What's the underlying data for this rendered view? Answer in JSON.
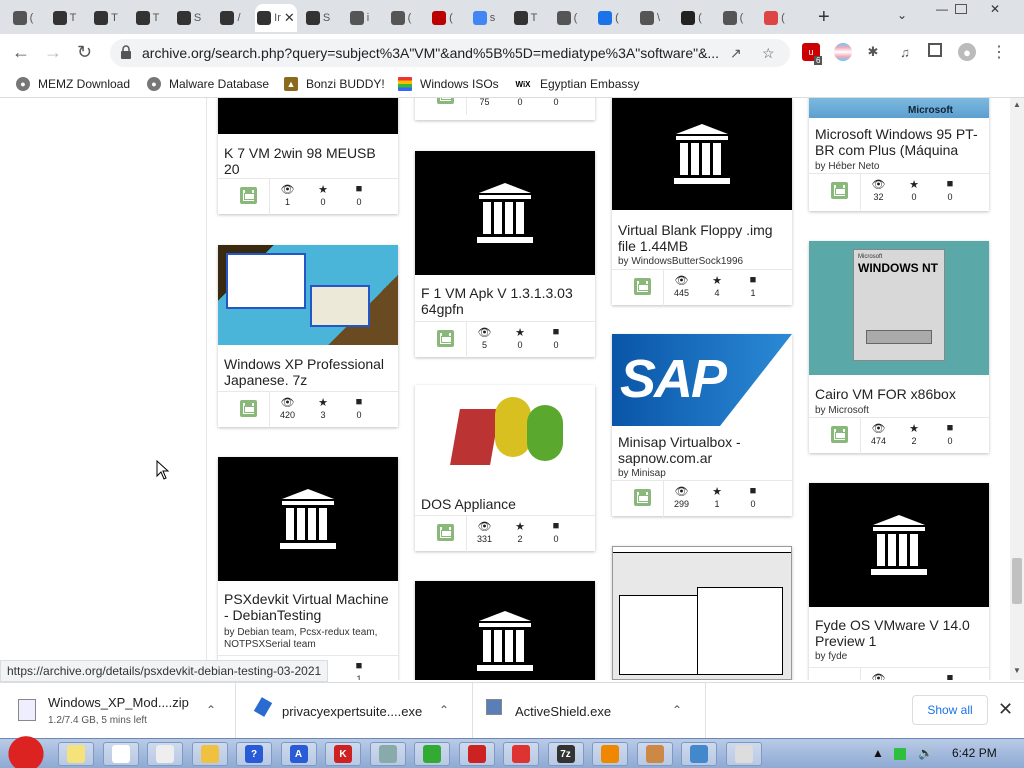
{
  "tabs": [
    {
      "label": "(",
      "color": "#555"
    },
    {
      "label": "T",
      "color": "#333"
    },
    {
      "label": "T",
      "color": "#333"
    },
    {
      "label": "T",
      "color": "#333"
    },
    {
      "label": "S",
      "color": "#333"
    },
    {
      "label": "/",
      "color": "#333"
    },
    {
      "label": "Ir",
      "color": "#333",
      "active": true
    },
    {
      "label": "S",
      "color": "#333"
    },
    {
      "label": "i",
      "color": "#555"
    },
    {
      "label": "(",
      "color": "#555"
    },
    {
      "label": "(",
      "color": "#b00"
    },
    {
      "label": "s",
      "color": "#4285f4"
    },
    {
      "label": "T",
      "color": "#333"
    },
    {
      "label": "(",
      "color": "#555"
    },
    {
      "label": "(",
      "color": "#1a73e8"
    },
    {
      "label": "\\",
      "color": "#555"
    },
    {
      "label": "(",
      "color": "#222"
    },
    {
      "label": "(",
      "color": "#555"
    },
    {
      "label": "(",
      "color": "#d44"
    }
  ],
  "toolbar": {
    "url": "archive.org/search.php?query=subject%3A\"VM\"&and%5B%5D=mediatype%3A\"software\"&...",
    "ext_badge": "6"
  },
  "bookmarks": [
    {
      "label": "MEMZ Download",
      "icon": "globe-icon"
    },
    {
      "label": "Malware Database",
      "icon": "globe-icon"
    },
    {
      "label": "Bonzi BUDDY!",
      "icon": "bonzi-icon"
    },
    {
      "label": "Windows ISOs",
      "icon": "windows-icon"
    },
    {
      "label": "Egyptian Embassy",
      "icon": "wix-icon"
    }
  ],
  "bookmark_wix_label": "WiX",
  "cards": [
    {
      "title": "K 7 VM 2win 98 MEUSB 20",
      "by": "",
      "views": "1",
      "favs": "0",
      "reviews": "0"
    },
    {
      "title": "Windows XP Professional Japanese. 7z",
      "by": "",
      "views": "420",
      "favs": "3",
      "reviews": "0"
    },
    {
      "title": "PSXdevkit Virtual Machine - DebianTesting",
      "by": "by Debian team, Pcsx-redux team, NOTPSXSerial team",
      "views": "",
      "favs": "",
      "reviews": "1"
    },
    {
      "title": "",
      "by": "",
      "views": "75",
      "favs": "0",
      "reviews": "0"
    },
    {
      "title": "F 1 VM Apk V 1.3.1.3.03 64gpfn",
      "by": "",
      "views": "5",
      "favs": "0",
      "reviews": "0"
    },
    {
      "title": "DOS Appliance",
      "by": "",
      "views": "331",
      "favs": "2",
      "reviews": "0"
    },
    {
      "title": "Virtual Blank Floppy .img file 1.44MB",
      "by": "by WindowsButterSock1996",
      "views": "445",
      "favs": "4",
      "reviews": "1"
    },
    {
      "title": "Minisap Virtualbox - sapnow.com.ar",
      "by": "by Minisap",
      "views": "299",
      "favs": "1",
      "reviews": "0"
    },
    {
      "title": "Microsoft Windows 95 PT-BR com Plus (Máquina",
      "by": "by Héber Neto",
      "views": "32",
      "favs": "0",
      "reviews": "0"
    },
    {
      "title": "Cairo VM FOR x86box",
      "by": "by Microsoft",
      "views": "474",
      "favs": "2",
      "reviews": "0"
    },
    {
      "title": "Fyde OS VMware V 14.0 Preview 1",
      "by": "by fyde",
      "views": "",
      "favs": "",
      "reviews": ""
    }
  ],
  "thumb_text": {
    "sap": "SAP",
    "ms95": "Microsoft",
    "winnt_top": "Microsoft",
    "winnt": "WINDOWS NT"
  },
  "status_url": "https://archive.org/details/psxdevkit-debian-testing-03-2021",
  "downloads": [
    {
      "name": "Windows_XP_Mod....zip",
      "sub": "1.2/7.4 GB, 5 mins left"
    },
    {
      "name": "privacyexpertsuite....exe",
      "sub": ""
    },
    {
      "name": "ActiveShield.exe",
      "sub": ""
    }
  ],
  "show_all": "Show all",
  "taskbar": {
    "icons": [
      "",
      "",
      "",
      "",
      "?",
      "A",
      "K",
      "",
      "",
      "",
      "",
      "7z",
      "",
      "",
      "",
      ""
    ],
    "clock": "6:42 PM"
  }
}
